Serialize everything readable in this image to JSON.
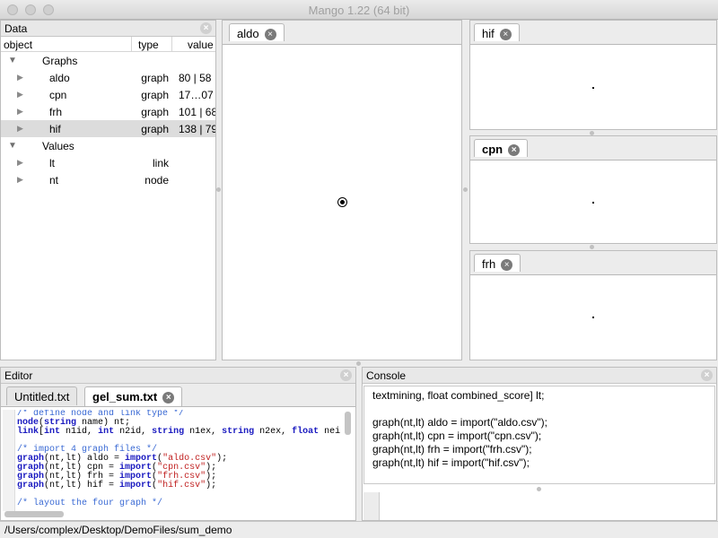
{
  "window": {
    "title": "Mango 1.22 (64 bit)"
  },
  "data_panel": {
    "title": "Data",
    "columns": {
      "object": "object",
      "type": "type",
      "value": "value"
    },
    "groups": [
      {
        "label": "Graphs",
        "items": [
          {
            "name": "aldo",
            "type": "graph",
            "value": "80 | 58"
          },
          {
            "name": "cpn",
            "type": "graph",
            "value": "17…07"
          },
          {
            "name": "frh",
            "type": "graph",
            "value": "101 | 68"
          },
          {
            "name": "hif",
            "type": "graph",
            "value": "138 | 79"
          }
        ]
      },
      {
        "label": "Values",
        "items": [
          {
            "name": "lt",
            "type": "link",
            "value": ""
          },
          {
            "name": "nt",
            "type": "node",
            "value": ""
          }
        ]
      }
    ],
    "selected_item": "hif"
  },
  "graph_views": {
    "main": {
      "tab": "aldo"
    },
    "side": [
      {
        "tab": "hif"
      },
      {
        "tab": "cpn"
      },
      {
        "tab": "frh"
      }
    ]
  },
  "editor": {
    "title": "Editor",
    "tabs": [
      {
        "label": "Untitled.txt",
        "active": false
      },
      {
        "label": "gel_sum.txt",
        "active": true
      }
    ],
    "lines": [
      [
        {
          "t": "/* define node and link type */",
          "c": "c-cm"
        }
      ],
      [
        {
          "t": "node",
          "c": "c-kw"
        },
        {
          "t": "(",
          "c": ""
        },
        {
          "t": "string",
          "c": "c-kw"
        },
        {
          "t": " name) nt;",
          "c": ""
        }
      ],
      [
        {
          "t": "link",
          "c": "c-kw"
        },
        {
          "t": "[",
          "c": ""
        },
        {
          "t": "int",
          "c": "c-kw"
        },
        {
          "t": " n1id, ",
          "c": ""
        },
        {
          "t": "int",
          "c": "c-kw"
        },
        {
          "t": " n2id, ",
          "c": ""
        },
        {
          "t": "string",
          "c": "c-kw"
        },
        {
          "t": " n1ex, ",
          "c": ""
        },
        {
          "t": "string",
          "c": "c-kw"
        },
        {
          "t": " n2ex, ",
          "c": ""
        },
        {
          "t": "float",
          "c": "c-kw"
        },
        {
          "t": " nei",
          "c": ""
        }
      ],
      [
        {
          "t": "",
          "c": ""
        }
      ],
      [
        {
          "t": "/* import 4 graph files */",
          "c": "c-cm"
        }
      ],
      [
        {
          "t": "graph",
          "c": "c-kw"
        },
        {
          "t": "(nt,lt) aldo = ",
          "c": ""
        },
        {
          "t": "import",
          "c": "c-kw"
        },
        {
          "t": "(",
          "c": ""
        },
        {
          "t": "\"aldo.csv\"",
          "c": "c-str"
        },
        {
          "t": ");",
          "c": ""
        }
      ],
      [
        {
          "t": "graph",
          "c": "c-kw"
        },
        {
          "t": "(nt,lt) cpn = ",
          "c": ""
        },
        {
          "t": "import",
          "c": "c-kw"
        },
        {
          "t": "(",
          "c": ""
        },
        {
          "t": "\"cpn.csv\"",
          "c": "c-str"
        },
        {
          "t": ");",
          "c": ""
        }
      ],
      [
        {
          "t": "graph",
          "c": "c-kw"
        },
        {
          "t": "(nt,lt) frh = ",
          "c": ""
        },
        {
          "t": "import",
          "c": "c-kw"
        },
        {
          "t": "(",
          "c": ""
        },
        {
          "t": "\"frh.csv\"",
          "c": "c-str"
        },
        {
          "t": ");",
          "c": ""
        }
      ],
      [
        {
          "t": "graph",
          "c": "c-kw"
        },
        {
          "t": "(nt,lt) hif = ",
          "c": ""
        },
        {
          "t": "import",
          "c": "c-kw"
        },
        {
          "t": "(",
          "c": ""
        },
        {
          "t": "\"hif.csv\"",
          "c": "c-str"
        },
        {
          "t": ");",
          "c": ""
        }
      ],
      [
        {
          "t": "",
          "c": ""
        }
      ],
      [
        {
          "t": "/* layout the four graph */",
          "c": "c-cm"
        }
      ]
    ]
  },
  "console": {
    "title": "Console",
    "lines": [
      "textmining, float combined_score] lt;",
      "",
      "graph(nt,lt) aldo = import(\"aldo.csv\");",
      "graph(nt,lt) cpn = import(\"cpn.csv\");",
      "graph(nt,lt) frh = import(\"frh.csv\");",
      "graph(nt,lt) hif = import(\"hif.csv\");"
    ],
    "input_value": ""
  },
  "status_bar": {
    "path": "/Users/complex/Desktop/DemoFiles/sum_demo"
  }
}
